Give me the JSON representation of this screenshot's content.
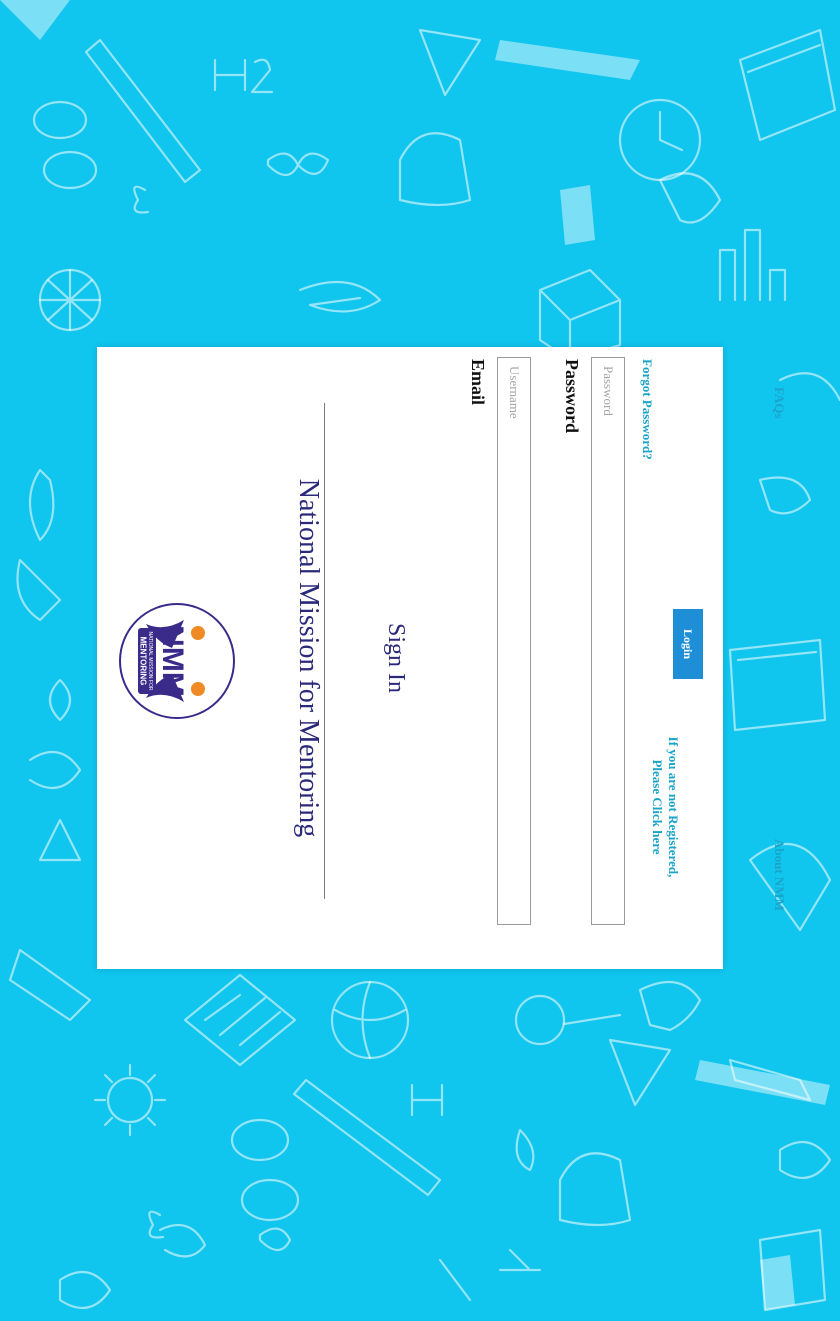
{
  "app": {
    "title": "National Mission for  Mentoring",
    "heading": "Sign In"
  },
  "logo": {
    "letters": "NMM",
    "banner_top": "NATIONAL MISSION FOR",
    "banner_bottom": "MENTORING"
  },
  "form": {
    "email_label": "Email",
    "email_placeholder": "Username",
    "password_label": "Password",
    "password_placeholder": "Password",
    "forgot_password": "Forgot Password?",
    "login_label": "Login",
    "register_line1": "If you are not Registered,",
    "register_line2": "Please Click here"
  },
  "footer": {
    "faqs": "FAQs",
    "about": "About NMM"
  },
  "colors": {
    "background": "#10c5ee",
    "brand": "#2b2a7a",
    "link": "#1aa4c8",
    "button": "#1e8fd6"
  }
}
